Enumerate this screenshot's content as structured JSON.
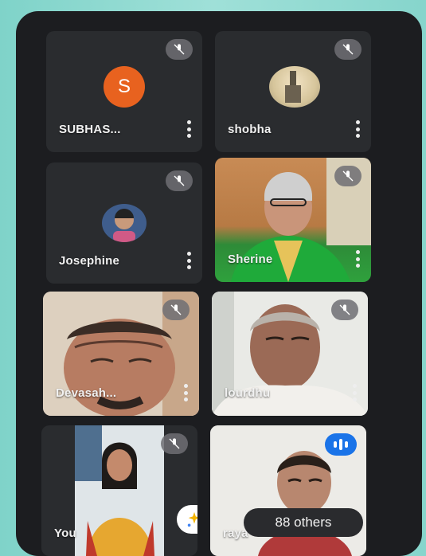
{
  "participants": [
    {
      "name": "SUBHAS...",
      "initial": "S",
      "avatar_color": "#e8621f",
      "muted": true
    },
    {
      "name": "shobha",
      "muted": true
    },
    {
      "name": "Josephine",
      "muted": true
    },
    {
      "name": "Sherine",
      "muted": true
    },
    {
      "name": "Devasah...",
      "muted": true
    },
    {
      "name": "lourdhu",
      "muted": true
    },
    {
      "name": "You",
      "muted": true
    },
    {
      "name": "raya",
      "speaking": true
    }
  ],
  "others_label": "88 others",
  "colors": {
    "speaking_indicator": "#1a73e8",
    "background": "#1c1d20"
  },
  "icons": [
    "mic-off-icon",
    "more-vert-icon",
    "audio-wave-icon",
    "sparkle-effects-icon"
  ]
}
